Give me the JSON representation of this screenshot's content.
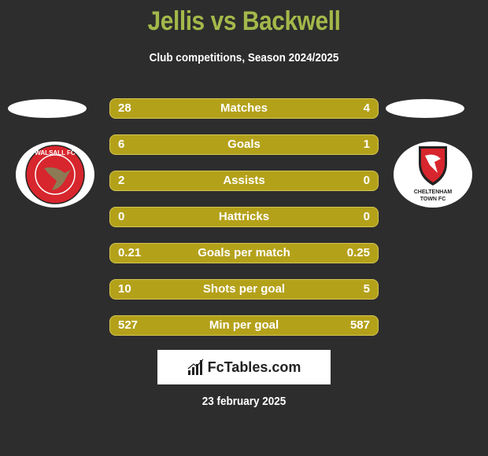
{
  "header": {
    "title": "Jellis vs Backwell",
    "subtitle": "Club competitions, Season 2024/2025"
  },
  "teams": {
    "left": {
      "name": "Walsall FC",
      "logo_text": "WALSALL FC",
      "color": "#d7262d"
    },
    "right": {
      "name": "Cheltenham Town FC",
      "logo_text_1": "CHELTENHAM",
      "logo_text_2": "TOWN FC",
      "color": "#d7262d"
    }
  },
  "stats": [
    {
      "label": "Matches",
      "left": "28",
      "right": "4"
    },
    {
      "label": "Goals",
      "left": "6",
      "right": "1"
    },
    {
      "label": "Assists",
      "left": "2",
      "right": "0"
    },
    {
      "label": "Hattricks",
      "left": "0",
      "right": "0"
    },
    {
      "label": "Goals per match",
      "left": "0.21",
      "right": "0.25"
    },
    {
      "label": "Shots per goal",
      "left": "10",
      "right": "5"
    },
    {
      "label": "Min per goal",
      "left": "527",
      "right": "587"
    }
  ],
  "brand": {
    "name": "FcTables.com",
    "icon": "bar-chart-icon"
  },
  "footer": {
    "date": "23 february 2025"
  },
  "colors": {
    "title": "#a3b84a",
    "bar": "#b4a11a",
    "background": "#2d2d2d"
  }
}
